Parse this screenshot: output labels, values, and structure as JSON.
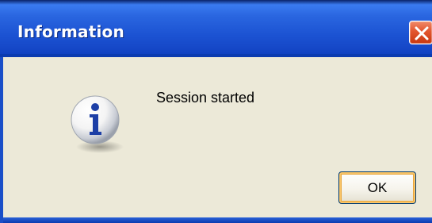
{
  "window": {
    "title": "Information"
  },
  "titlebar": {
    "close_icon": "close-icon"
  },
  "content": {
    "icon": "info-icon",
    "message": "Session started"
  },
  "buttons": {
    "ok_label": "OK"
  },
  "colors": {
    "titlebar": "#1b52d2",
    "body": "#ece9d8",
    "close": "#e2552e",
    "button_focus": "#f9c56a"
  }
}
